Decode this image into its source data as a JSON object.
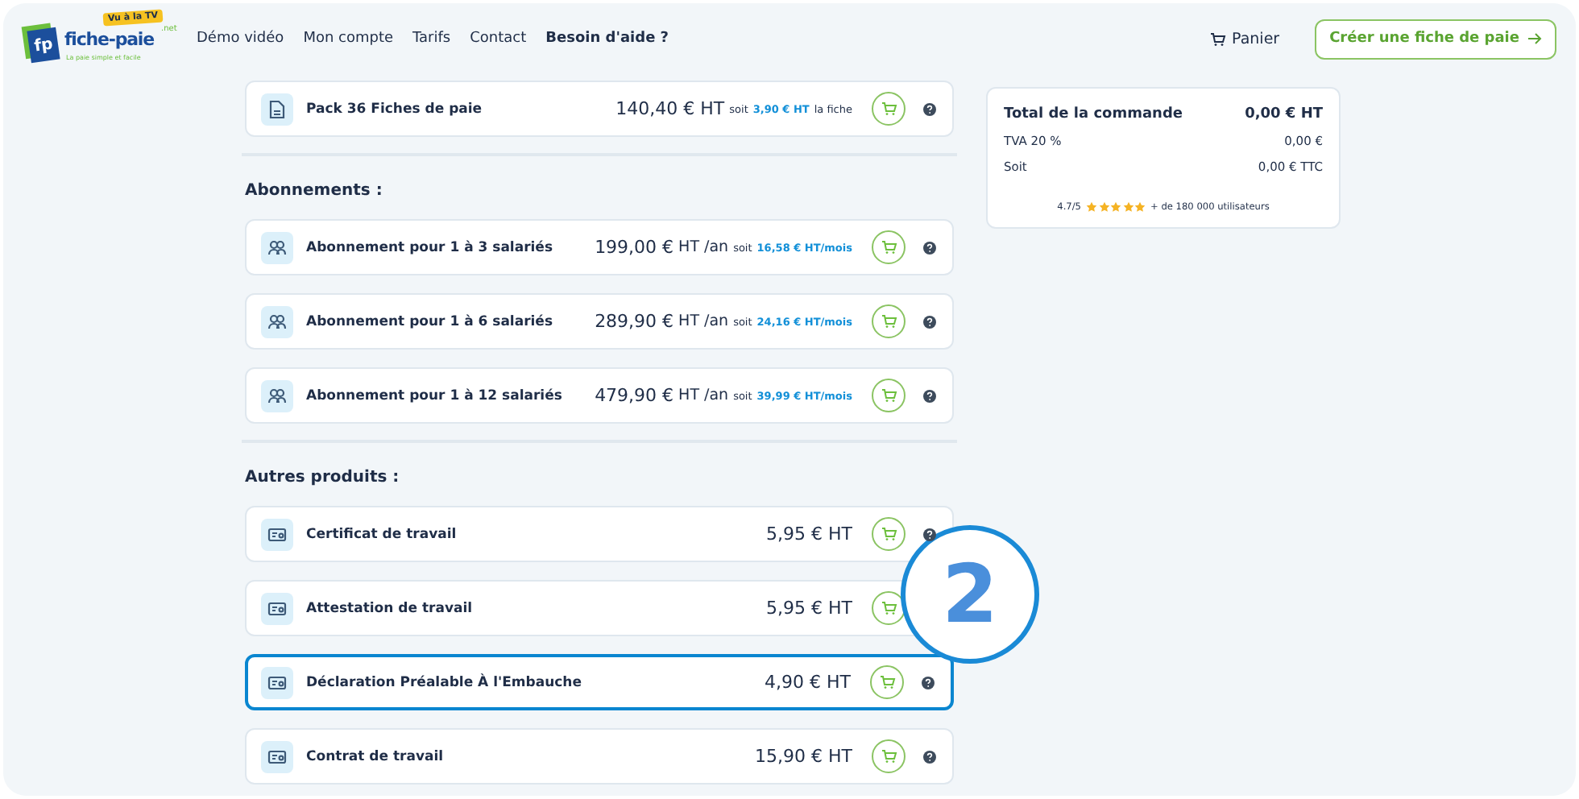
{
  "header": {
    "logo": {
      "initials": "fp",
      "name": "fiche-paie",
      "domain": ".net",
      "badge": "Vu à la TV",
      "tagline": "La paie simple et facile"
    },
    "nav": [
      "Démo vidéo",
      "Mon compte",
      "Tarifs",
      "Contact",
      "Besoin d'aide ?"
    ],
    "cart": "Panier",
    "cta": "Créer une fiche de paie"
  },
  "sections": [
    {
      "products": [
        {
          "kind": "document",
          "name": "Pack 36 Fiches de paie",
          "price": "140,40 € HT",
          "note": {
            "prefix": "soit",
            "value": "3,90 €",
            "value_unit": "HT",
            "suffix": "la fiche"
          },
          "highlighted": false
        }
      ]
    },
    {
      "title": "Abonnements :",
      "products": [
        {
          "kind": "users",
          "name": "Abonnement pour 1 à 3 salariés",
          "price": "199,00 €",
          "unit": "HT /an",
          "note": {
            "prefix": "soit",
            "value": "16,58 €",
            "value_unit": "HT/mois"
          },
          "highlighted": false
        },
        {
          "kind": "users",
          "name": "Abonnement pour 1 à 6 salariés",
          "price": "289,90 €",
          "unit": "HT /an",
          "note": {
            "prefix": "soit",
            "value": "24,16 €",
            "value_unit": "HT/mois"
          },
          "highlighted": false
        },
        {
          "kind": "users",
          "name": "Abonnement pour 1 à 12 salariés",
          "price": "479,90 €",
          "unit": "HT /an",
          "note": {
            "prefix": "soit",
            "value": "39,99 €",
            "value_unit": "HT/mois"
          },
          "highlighted": false
        }
      ]
    },
    {
      "title": "Autres produits :",
      "products": [
        {
          "kind": "card",
          "name": "Certificat de travail",
          "price": "5,95 € HT",
          "highlighted": false
        },
        {
          "kind": "card",
          "name": "Attestation de travail",
          "price": "5,95 € HT",
          "highlighted": false,
          "help": false
        },
        {
          "kind": "card",
          "name": "Déclaration Préalable À l'Embauche",
          "price": "4,90 € HT",
          "highlighted": true
        },
        {
          "kind": "card",
          "name": "Contrat de travail",
          "price": "15,90 € HT",
          "highlighted": false
        }
      ]
    }
  ],
  "summary": {
    "lines": [
      {
        "label": "Total de la commande",
        "value": "0,00 € HT",
        "emphasis": true
      },
      {
        "label": "TVA 20 %",
        "value": "0,00 €",
        "emphasis": false
      },
      {
        "label": "Soit",
        "value": "0,00 € TTC",
        "emphasis": false
      }
    ],
    "rating": {
      "score": "4.7/5",
      "stars": 5,
      "users": "+ de 180 000 utilisateurs"
    }
  },
  "callout": {
    "number": "2"
  }
}
